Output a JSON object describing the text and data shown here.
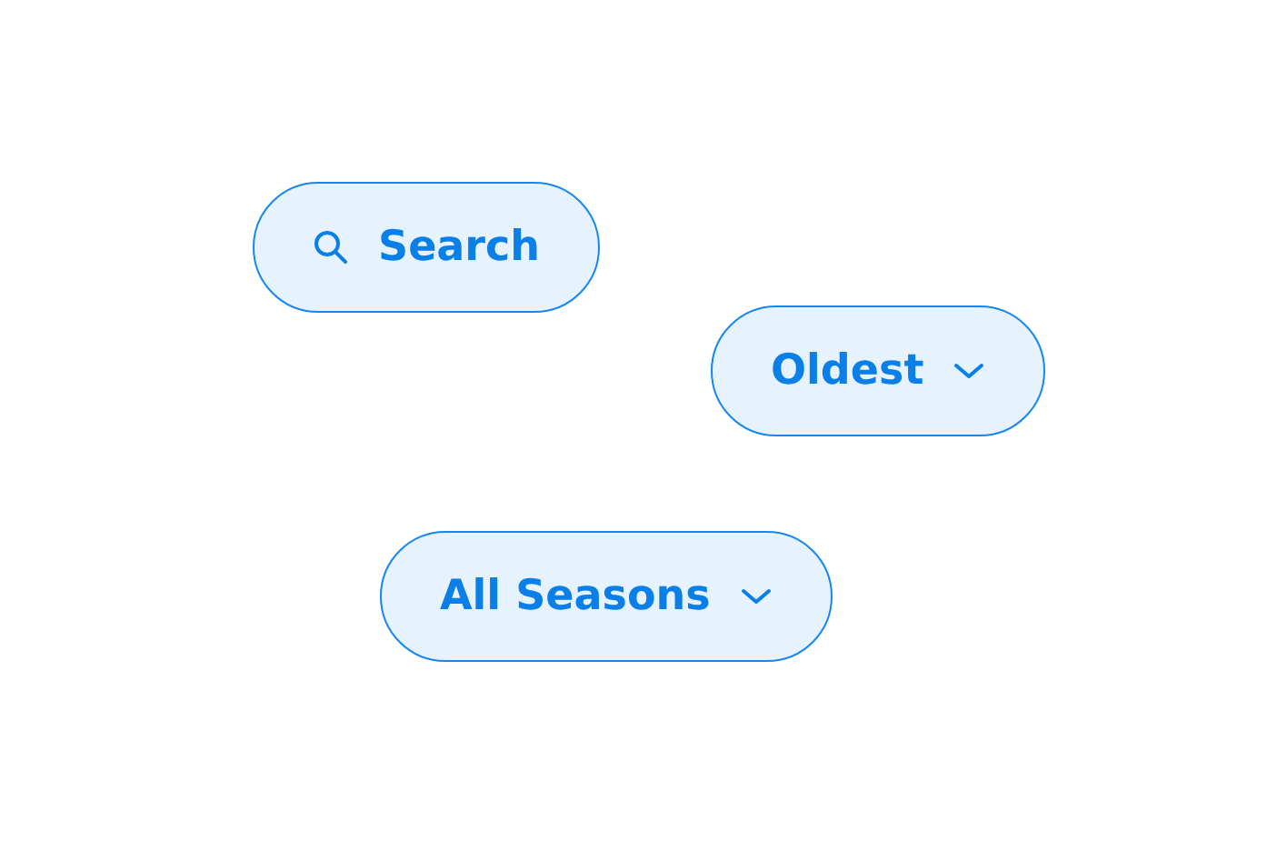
{
  "buttons": [
    {
      "label": "Search",
      "kind": "search"
    },
    {
      "label": "Oldest",
      "kind": "dropdown"
    },
    {
      "label": "All Seasons",
      "kind": "dropdown"
    }
  ]
}
